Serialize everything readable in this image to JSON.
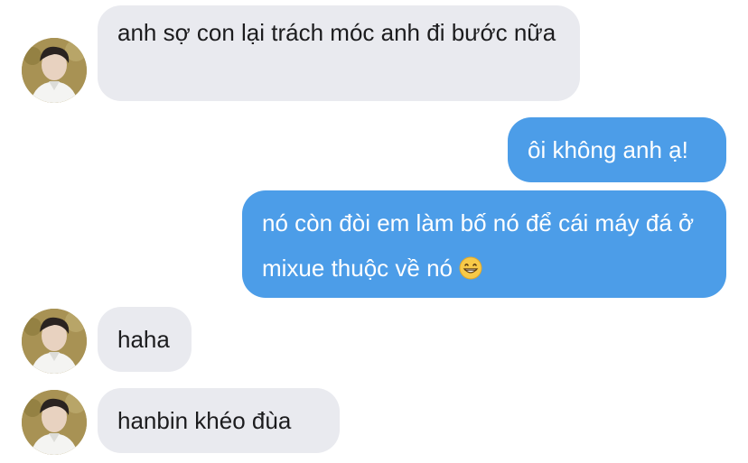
{
  "messages": [
    {
      "direction": "incoming",
      "text": "anh sợ con lại trách móc anh đi bước nữa"
    },
    {
      "direction": "outgoing",
      "text": "ôi không anh ạ!"
    },
    {
      "direction": "outgoing",
      "text": "nó còn đòi em làm bố nó để cái máy đá ở mixue thuộc về nó",
      "emoji": "grinning-face-emoji"
    },
    {
      "direction": "incoming",
      "text": "haha"
    },
    {
      "direction": "incoming",
      "text": "hanbin khéo đùa"
    }
  ],
  "colors": {
    "incoming_bubble": "#e9eaef",
    "outgoing_bubble": "#4c9de8",
    "outgoing_text": "#ffffff",
    "incoming_text": "#1c1c1e"
  }
}
